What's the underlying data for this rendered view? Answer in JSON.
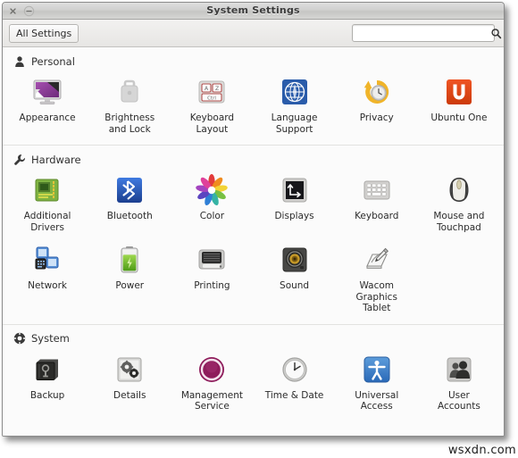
{
  "window": {
    "title": "System Settings",
    "close_label": "✕",
    "minimize_label": "–"
  },
  "toolbar": {
    "all_settings_label": "All Settings",
    "search_value": "",
    "search_placeholder": "",
    "search_icon": "search-icon"
  },
  "sections": [
    {
      "id": "personal",
      "label": "Personal",
      "icon": "person-icon",
      "items": [
        {
          "id": "appearance",
          "label": "Appearance",
          "icon": "appearance-monitor-icon"
        },
        {
          "id": "brightness-lock",
          "label": "Brightness\nand Lock",
          "icon": "brightness-lock-icon"
        },
        {
          "id": "keyboard-layout",
          "label": "Keyboard\nLayout",
          "icon": "keyboard-layout-icon"
        },
        {
          "id": "language-support",
          "label": "Language\nSupport",
          "icon": "language-support-icon"
        },
        {
          "id": "privacy",
          "label": "Privacy",
          "icon": "privacy-clock-icon"
        },
        {
          "id": "ubuntu-one",
          "label": "Ubuntu One",
          "icon": "ubuntu-one-icon"
        }
      ]
    },
    {
      "id": "hardware",
      "label": "Hardware",
      "icon": "wrench-icon",
      "items": [
        {
          "id": "additional-drivers",
          "label": "Additional\nDrivers",
          "icon": "additional-drivers-chip-icon"
        },
        {
          "id": "bluetooth",
          "label": "Bluetooth",
          "icon": "bluetooth-icon"
        },
        {
          "id": "color",
          "label": "Color",
          "icon": "color-wheel-icon"
        },
        {
          "id": "displays",
          "label": "Displays",
          "icon": "displays-icon"
        },
        {
          "id": "keyboard",
          "label": "Keyboard",
          "icon": "keyboard-icon"
        },
        {
          "id": "mouse-touchpad",
          "label": "Mouse and\nTouchpad",
          "icon": "mouse-icon"
        },
        {
          "id": "network",
          "label": "Network",
          "icon": "network-icon"
        },
        {
          "id": "power",
          "label": "Power",
          "icon": "battery-icon"
        },
        {
          "id": "printing",
          "label": "Printing",
          "icon": "printer-icon"
        },
        {
          "id": "sound",
          "label": "Sound",
          "icon": "speaker-icon"
        },
        {
          "id": "wacom",
          "label": "Wacom\nGraphics\nTablet",
          "icon": "wacom-tablet-icon"
        }
      ]
    },
    {
      "id": "system",
      "label": "System",
      "icon": "system-gear-icon",
      "items": [
        {
          "id": "backup",
          "label": "Backup",
          "icon": "safe-icon"
        },
        {
          "id": "details",
          "label": "Details",
          "icon": "details-gears-icon"
        },
        {
          "id": "management-service",
          "label": "Management\nService",
          "icon": "management-ring-icon"
        },
        {
          "id": "time-date",
          "label": "Time & Date",
          "icon": "clock-icon"
        },
        {
          "id": "universal-access",
          "label": "Universal\nAccess",
          "icon": "accessibility-icon"
        },
        {
          "id": "user-accounts",
          "label": "User\nAccounts",
          "icon": "users-icon"
        }
      ]
    }
  ],
  "watermark": "wsxdn.com",
  "colors": {
    "titlebar": "#d0d0cf",
    "content_bg": "#fbfbfb",
    "ubuntu_orange": "#dd4814",
    "management_purple": "#8e1c5b",
    "bluetooth_blue": "#2b5fc4",
    "power_green": "#6cbd22",
    "text": "#2b2b2b"
  }
}
